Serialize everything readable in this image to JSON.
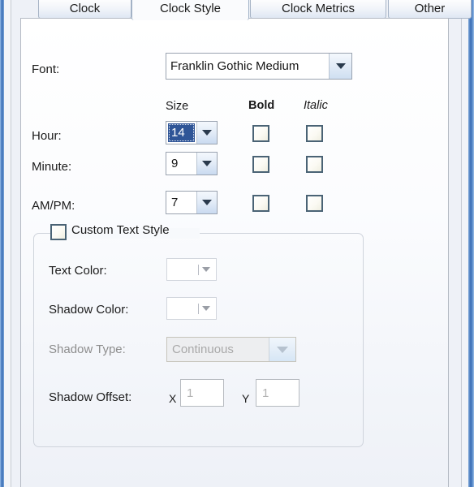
{
  "window": {
    "tabs": [
      {
        "label": "Clock",
        "selected": false
      },
      {
        "label": "Clock Style",
        "selected": true
      },
      {
        "label": "Clock Metrics",
        "selected": false
      },
      {
        "label": "Other",
        "selected": false
      }
    ]
  },
  "font_row": {
    "label": "Font:",
    "value": "Franklin Gothic Medium",
    "dropdown_icon": "chevron-down-icon"
  },
  "columns": {
    "size": "Size",
    "bold": "Bold",
    "italic": "Italic"
  },
  "size_rows": [
    {
      "label": "Hour:",
      "size": "14",
      "selected": true,
      "bold": false,
      "italic": false
    },
    {
      "label": "Minute:",
      "size": "9",
      "selected": false,
      "bold": false,
      "italic": false
    },
    {
      "label": "AM/PM:",
      "size": "7",
      "selected": false,
      "bold": false,
      "italic": false
    }
  ],
  "custom_text_style": {
    "title": "Custom Text Style",
    "checked": false,
    "text_color": {
      "label": "Text Color:",
      "value": "",
      "disabled": true,
      "icon": "chevron-down-icon"
    },
    "shadow_color": {
      "label": "Shadow Color:",
      "value": "",
      "disabled": true,
      "icon": "chevron-down-icon"
    },
    "shadow_type": {
      "label": "Shadow Type:",
      "value": "Continuous",
      "disabled": true,
      "icon": "chevron-down-icon"
    },
    "shadow_offset": {
      "label": "Shadow Offset:",
      "x_label": "X",
      "x_value": "1",
      "y_label": "Y",
      "y_value": "1",
      "disabled": true
    }
  },
  "colors": {
    "frame_blue": "#3d6fb5",
    "panel_bg": "#fafbfd",
    "selection_blue": "#2f5597",
    "text": "#1b1b1b",
    "disabled_text": "#a9a9a9",
    "checkbox_border": "#4a6375"
  }
}
